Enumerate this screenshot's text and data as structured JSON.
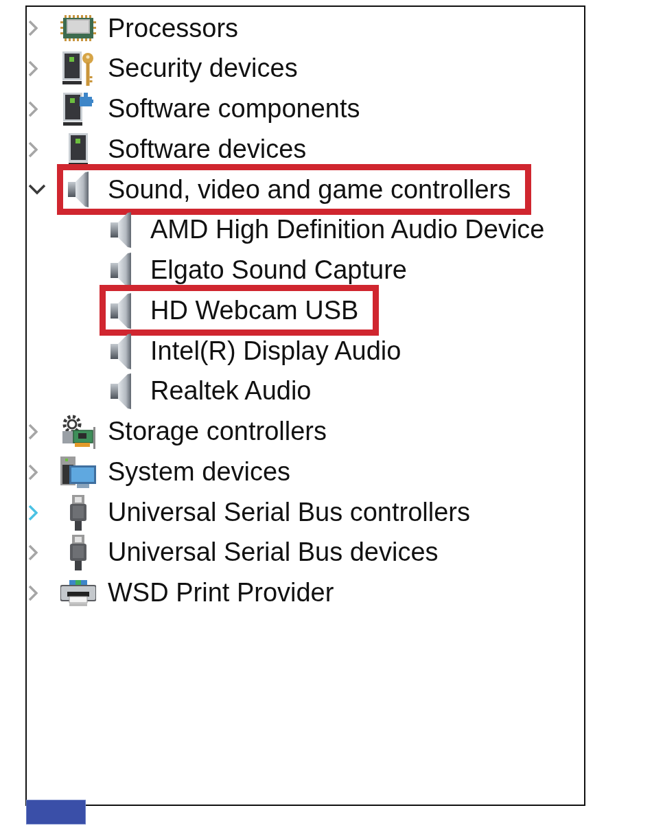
{
  "device_tree": {
    "items": [
      {
        "kind": "processor",
        "label": "Processors",
        "expanded": false,
        "hovered": false,
        "highlighted": false
      },
      {
        "kind": "security",
        "label": "Security devices",
        "expanded": false,
        "hovered": false,
        "highlighted": false
      },
      {
        "kind": "software_component",
        "label": "Software components",
        "expanded": false,
        "hovered": false,
        "highlighted": false
      },
      {
        "kind": "software_device",
        "label": "Software devices",
        "expanded": false,
        "hovered": false,
        "highlighted": false
      },
      {
        "kind": "speaker",
        "label": "Sound, video and game controllers",
        "expanded": true,
        "hovered": false,
        "highlighted": true,
        "children": [
          {
            "kind": "speaker",
            "label": "AMD High Definition Audio Device",
            "highlighted": false
          },
          {
            "kind": "speaker",
            "label": "Elgato Sound Capture",
            "highlighted": false
          },
          {
            "kind": "speaker",
            "label": "HD Webcam USB",
            "highlighted": true
          },
          {
            "kind": "speaker",
            "label": "Intel(R) Display Audio",
            "highlighted": false
          },
          {
            "kind": "speaker",
            "label": "Realtek Audio",
            "highlighted": false
          }
        ]
      },
      {
        "kind": "storage",
        "label": "Storage controllers",
        "expanded": false,
        "hovered": false,
        "highlighted": false
      },
      {
        "kind": "system",
        "label": "System devices",
        "expanded": false,
        "hovered": false,
        "highlighted": false
      },
      {
        "kind": "usb",
        "label": "Universal Serial Bus controllers",
        "expanded": false,
        "hovered": true,
        "highlighted": false
      },
      {
        "kind": "usb",
        "label": "Universal Serial Bus devices",
        "expanded": false,
        "hovered": false,
        "highlighted": false
      },
      {
        "kind": "printer",
        "label": "WSD Print Provider",
        "expanded": false,
        "hovered": false,
        "highlighted": false
      }
    ]
  }
}
